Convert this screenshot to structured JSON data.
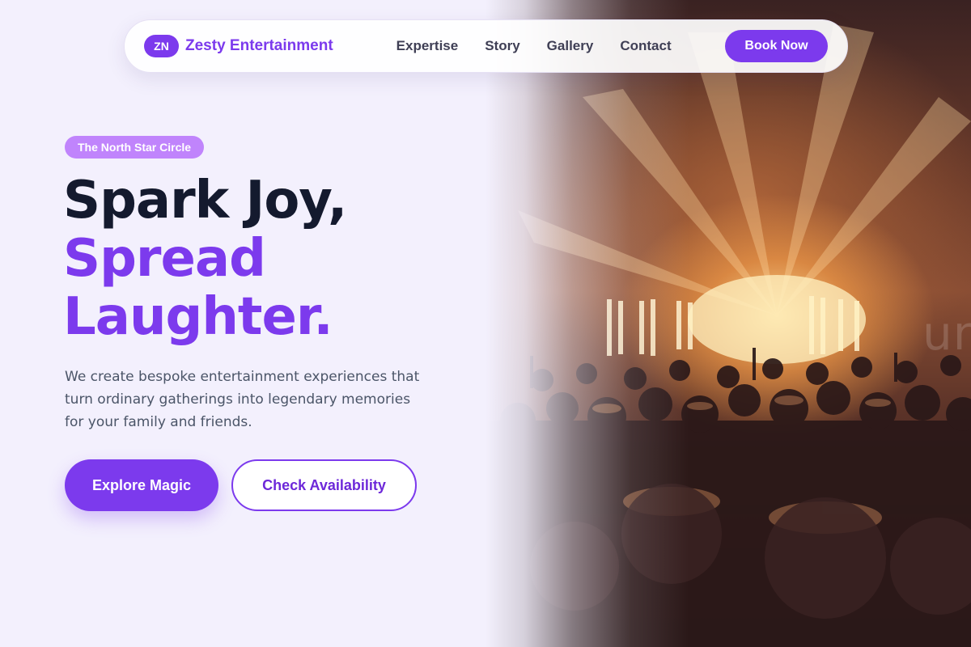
{
  "brand": {
    "badge": "ZN",
    "name": "Zesty Entertainment"
  },
  "nav": {
    "links": [
      "Expertise",
      "Story",
      "Gallery",
      "Contact"
    ],
    "cta": "Book Now"
  },
  "hero": {
    "eyebrow": "The North Star Circle",
    "headline": [
      "Spark Joy,",
      "Spread",
      "Laughter."
    ],
    "lead": "We create bespoke entertainment experiences that turn ordinary gatherings into legendary memories for your family and friends.",
    "primary_cta": "Explore Magic",
    "secondary_cta": "Check Availability",
    "image_watermark": "unnyhamdesign.com"
  },
  "colors": {
    "accent": "#7c3aed",
    "accent_light": "#c084fc",
    "page_bg": "#f3f0fd",
    "headline_dark": "#141a2e"
  }
}
